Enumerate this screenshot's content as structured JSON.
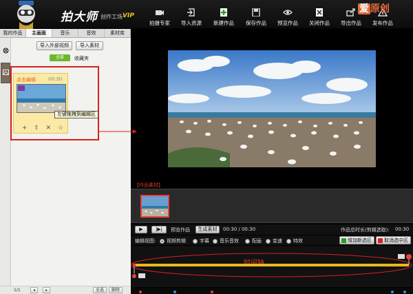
{
  "app": {
    "logo_text": "拍大师",
    "logo_sub": "创作工场",
    "vip": "VIP",
    "watermark_a": "爱",
    "watermark_b": "原创"
  },
  "toolbar": {
    "items": [
      {
        "label": "拍摄专家",
        "icon": "camera-icon"
      },
      {
        "label": "导入资源",
        "icon": "import-icon"
      },
      {
        "label": "新建作品",
        "icon": "plus-icon"
      },
      {
        "label": "保存作品",
        "icon": "save-icon"
      },
      {
        "label": "预览作品",
        "icon": "eye-icon"
      },
      {
        "label": "关闭作品",
        "icon": "close-icon"
      },
      {
        "label": "导出作品",
        "icon": "export-icon"
      },
      {
        "label": "发布作品",
        "icon": "publish-icon"
      }
    ]
  },
  "left_panel": {
    "tabs": [
      "我的作品",
      "主画面",
      "音乐",
      "音效",
      "素材库"
    ],
    "active_tab": 1,
    "import_video_btn": "导入外部视频",
    "import_material_btn": "导入素材",
    "folder_tab": "全部",
    "folder_label": "收藏夹",
    "card": {
      "title": "点击编辑",
      "duration": "00:30",
      "actions": [
        "+",
        "⇪",
        "✕",
        "☆"
      ]
    },
    "tooltip": "左键拖拽到编辑区",
    "pager": {
      "page": "1/1",
      "prev": "◂",
      "next": "▸",
      "select_all": "全选",
      "delete": "删除"
    }
  },
  "right_panel": {
    "section_label": "【作品素材】",
    "controls": {
      "play": "▶",
      "step": "|▶|",
      "preview_btn": "预览作品",
      "generate_btn": "生成素材",
      "time": "00:30 / 00:30",
      "total_label": "作品总时长(剪辑选取):",
      "total_value": "00:30"
    },
    "view": {
      "label": "编辑视图:",
      "options": [
        "视频剪辑",
        "字幕",
        "音乐音效",
        "配画",
        "变速",
        "特效"
      ],
      "selected": 0,
      "add_region": "增加新选区",
      "cancel_region": "取消选中区"
    },
    "timeline_label": "时间轴"
  },
  "colors": {
    "accent_red": "#d92020",
    "timeline_yellow": "#f0c020",
    "green": "#3a9a2a"
  }
}
